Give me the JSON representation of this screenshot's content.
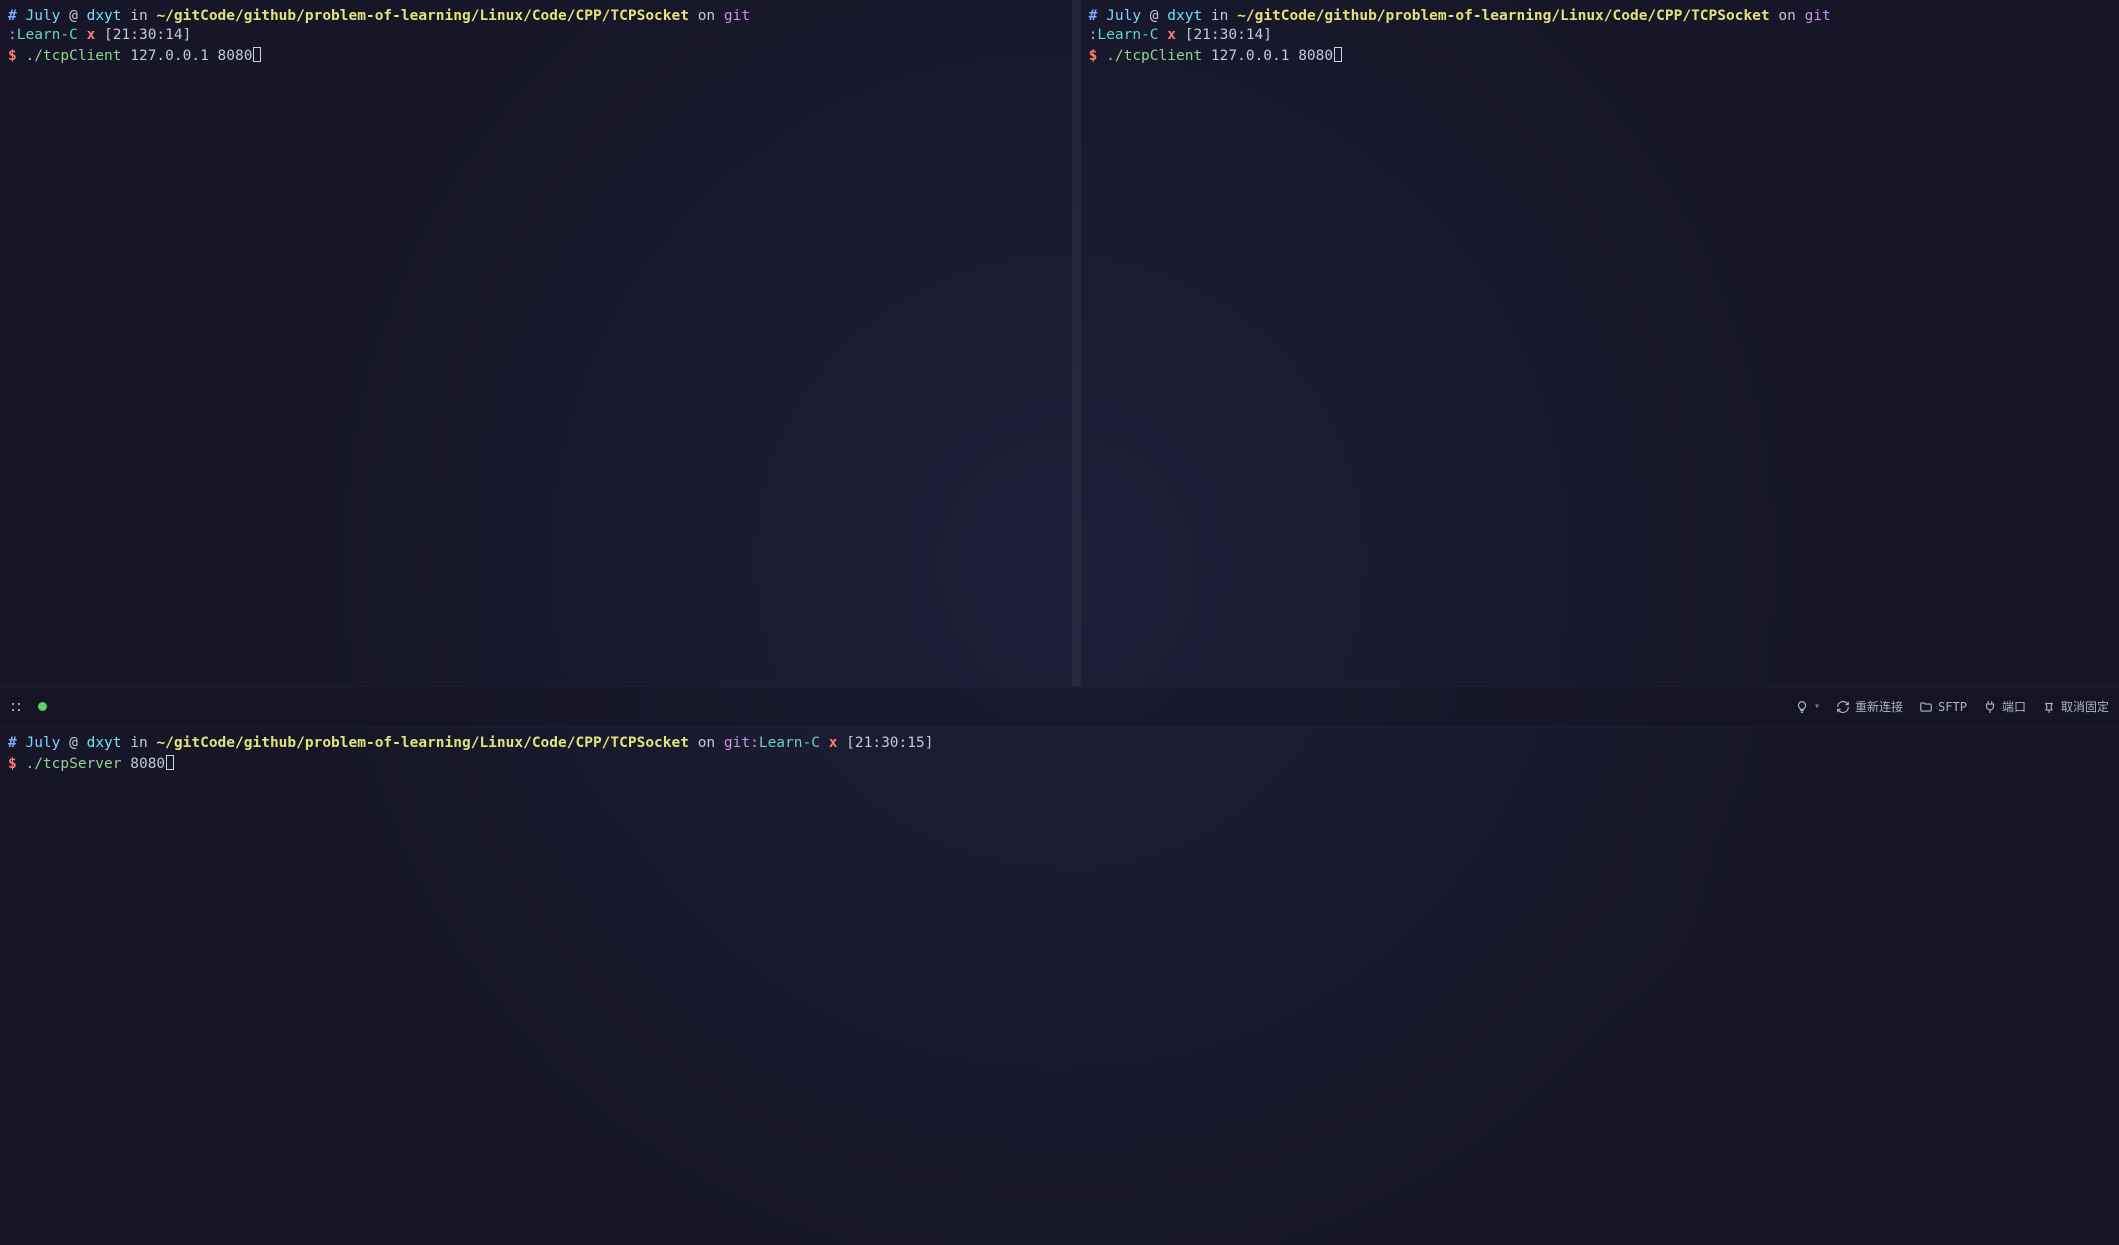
{
  "prompt_common": {
    "hash": "#",
    "user": "July",
    "at": "@",
    "host": "dxyt",
    "in": "in",
    "path": "~/gitCode/github/problem-of-learning/Linux/Code/CPP/TCPSocket",
    "on": "on",
    "git": "git",
    "colon": ":",
    "branch": "Learn-C",
    "x": "x",
    "dollar": "$"
  },
  "panes": {
    "top_left": {
      "time": "[21:30:14]",
      "command": "./tcpClient",
      "args": "127.0.0.1 8080"
    },
    "top_right": {
      "time": "[21:30:14]",
      "command": "./tcpClient",
      "args": "127.0.0.1 8080"
    },
    "bottom": {
      "time": "[21:30:15]",
      "command": "./tcpServer",
      "args": "8080"
    }
  },
  "toolbar": {
    "reconnect": "重新连接",
    "sftp": "SFTP",
    "port": "端口",
    "unpin": "取消固定"
  }
}
